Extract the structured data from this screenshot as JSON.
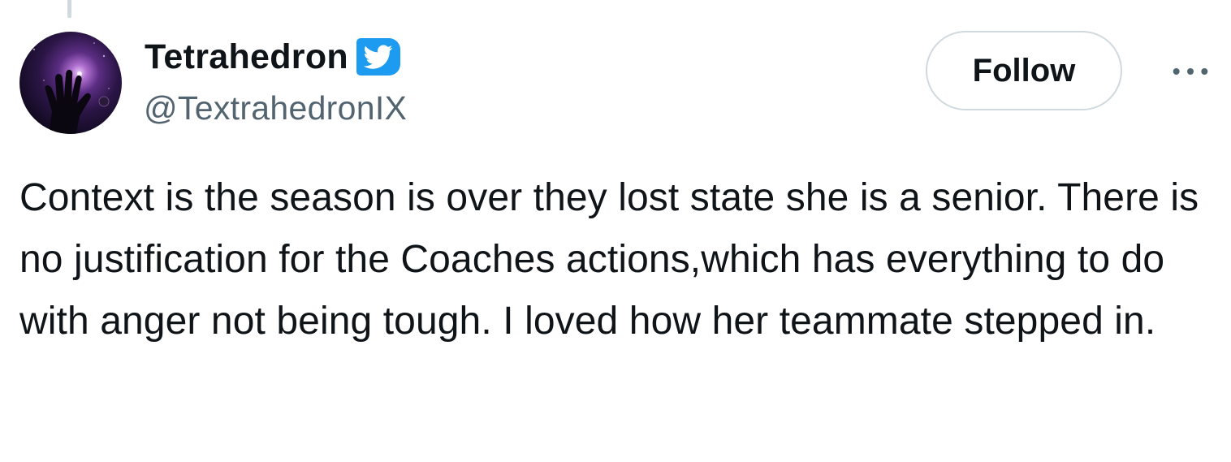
{
  "author": {
    "display_name": "Tetrahedron",
    "handle": "@TextrahedronIX",
    "verified": true,
    "avatar_icon": "cosmic-hand-avatar",
    "badge_icon": "twitter-bird-verified-icon"
  },
  "actions": {
    "follow_label": "Follow",
    "more_icon": "more-options-icon"
  },
  "tweet": {
    "text": "Context is the season is over they lost state she is a senior. There is no justification for the Coaches actions,which has everything to do with anger not being tough. I loved how her teammate stepped in."
  },
  "colors": {
    "primary_text": "#0f1419",
    "secondary_text": "#536471",
    "verified_blue": "#1d9bf0",
    "border": "#cfd9de"
  }
}
